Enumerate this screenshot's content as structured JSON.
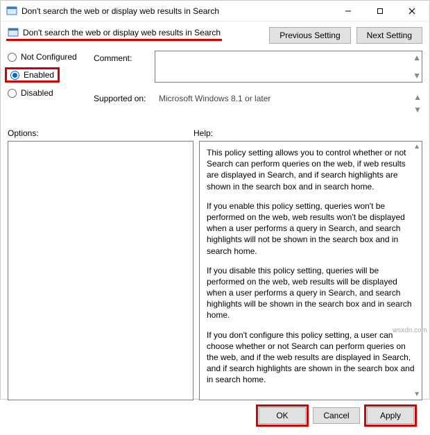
{
  "titlebar": {
    "title": "Don't search the web or display web results in Search"
  },
  "nav": {
    "previous": "Previous Setting",
    "next": "Next Setting"
  },
  "policy": {
    "title": "Don't search the web or display web results in Search"
  },
  "radios": {
    "not_configured": "Not Configured",
    "enabled": "Enabled",
    "disabled": "Disabled"
  },
  "labels": {
    "comment": "Comment:",
    "supported": "Supported on:",
    "options": "Options:",
    "help": "Help:"
  },
  "supported_text": "Microsoft Windows 8.1 or later",
  "help": {
    "p1": "This policy setting allows you to control whether or not Search can perform queries on the web, if web results are displayed in Search, and if search highlights are shown in the search box and in search home.",
    "p2": "If you enable this policy setting, queries won't be performed on the web, web results won't be displayed when a user performs a query in Search, and search highlights will not be shown in the search box and in search home.",
    "p3": "If you disable this policy setting, queries will be performed on the web, web results will be displayed when a user performs a query in Search, and search highlights will be shown in the search box and in search home.",
    "p4": "If you don't configure this policy setting, a user can choose whether or not Search can perform queries on the web, and if the web results are displayed in Search, and if search highlights are shown in the search box and in search home."
  },
  "footer": {
    "ok": "OK",
    "cancel": "Cancel",
    "apply": "Apply"
  },
  "watermark": "wsxdn.com"
}
